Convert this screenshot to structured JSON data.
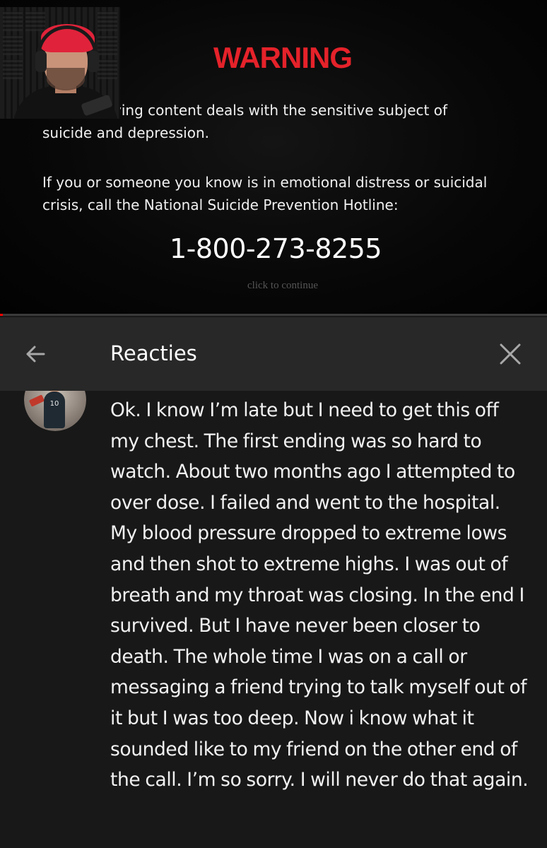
{
  "video": {
    "warning_title": "WARNING",
    "warning_line1": "ving content deals with the sensitive subject of suicide and depression.",
    "warning_line2": "If you or someone you know is in emotional distress or suicidal crisis, call the National Suicide Prevention Hotline:",
    "hotline_number": "1-800-273-8255",
    "continue_hint": "click to continue",
    "progress_fraction": 0.005,
    "colors": {
      "warning_red": "#e5222a",
      "progress_red": "#ff0000"
    }
  },
  "panel": {
    "title": "Reacties",
    "back_icon": "arrow-left-icon",
    "close_icon": "close-icon"
  },
  "comment": {
    "avatar_jersey_number": "10",
    "text": "Ok. I know I’m late but I need to get this off my chest. The first ending was so hard to watch. About two months ago I attempted to over dose. I failed and went to the hospital. My blood pressure dropped to extreme lows and then shot to extreme highs. I was out of breath and my throat was closing. In the end I survived. But I have never been closer to death. The whole time I was on a call or messaging a friend trying to talk myself out of it but I was too deep. Now i know what it sounded like to my friend on the other end of the call. I’m so sorry. I will never do that again."
  }
}
